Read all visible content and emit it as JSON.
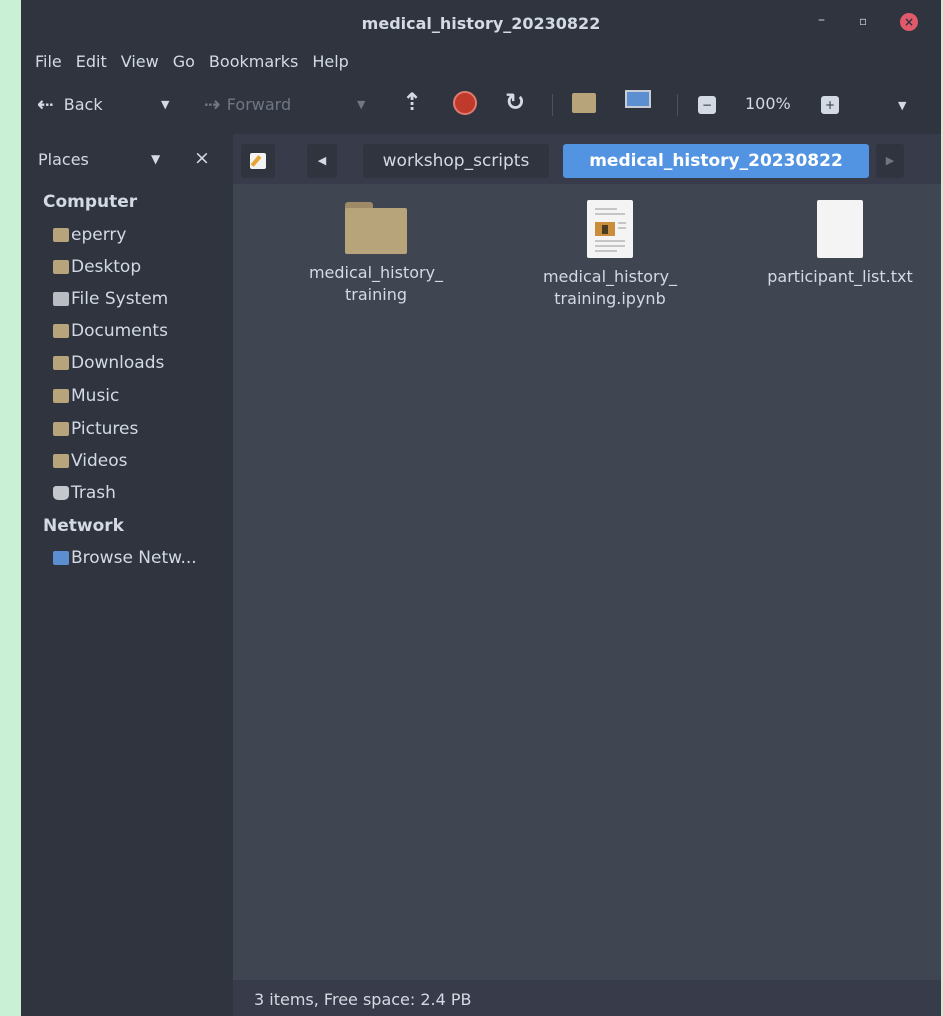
{
  "window": {
    "title": "medical_history_20230822",
    "minimize_label": "–",
    "maximize_label": "▫",
    "close_label": "×"
  },
  "menu": [
    "File",
    "Edit",
    "View",
    "Go",
    "Bookmarks",
    "Help"
  ],
  "toolbar": {
    "back_label": "Back",
    "forward_label": "Forward",
    "zoom_level": "100%"
  },
  "sidebar": {
    "header_label": "Places",
    "sections": [
      {
        "title": "Computer",
        "items": [
          "eperry",
          "Desktop",
          "File System",
          "Documents",
          "Downloads",
          "Music",
          "Pictures",
          "Videos",
          "Trash"
        ]
      },
      {
        "title": "Network",
        "items": [
          "Browse Netw..."
        ]
      }
    ]
  },
  "location": {
    "crumbs": [
      "workshop_scripts",
      "medical_history_20230822"
    ],
    "active_index": 1
  },
  "files": [
    {
      "type": "folder",
      "line1": "medical_history_",
      "line2": "training"
    },
    {
      "type": "notebook",
      "line1": "medical_history_",
      "line2": "training.ipynb"
    },
    {
      "type": "text",
      "line1": "participant_list.txt",
      "line2": ""
    }
  ],
  "status": {
    "text": "3 items, Free space: 2.4 PB"
  },
  "colors": {
    "accent": "#5294e2",
    "folder": "#b8a47a",
    "close": "#e05a6b",
    "stop": "#c0392b"
  },
  "icons": {
    "back": "back-arrow-icon",
    "forward": "forward-arrow-icon",
    "up": "up-arrow-icon",
    "stop": "stop-icon",
    "reload": "reload-icon",
    "home": "home-folder-icon",
    "computer": "computer-icon",
    "zoom_out": "zoom-out-icon",
    "zoom_in": "zoom-in-icon"
  }
}
